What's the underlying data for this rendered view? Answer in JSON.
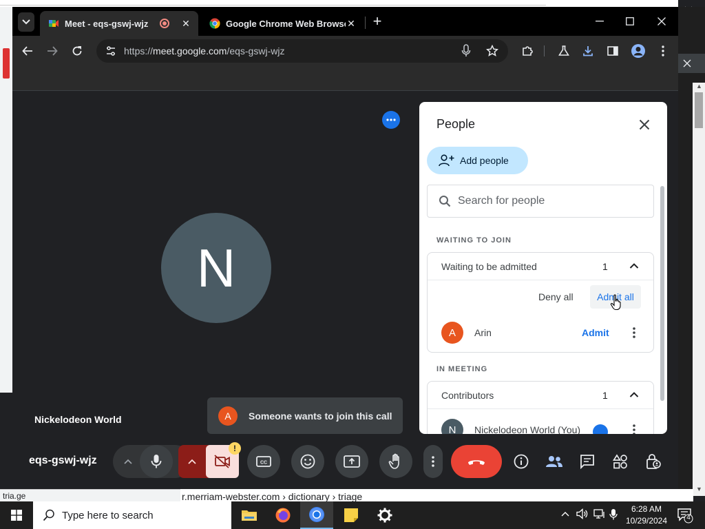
{
  "browser": {
    "tabs": [
      {
        "title": "Meet - eqs-gswj-wjz",
        "recording": true
      },
      {
        "title": "Google Chrome Web Browser",
        "recording": false
      }
    ],
    "url_prefix": "https://",
    "url_host": "meet.google.com",
    "url_path": "/eqs-gswj-wjz",
    "status_url": "tria.ge",
    "background_text": "r.merriam-webster.com › dictionary › triage"
  },
  "meet": {
    "avatar_letter": "N",
    "self_name": "Nickelodeon World",
    "meeting_code": "eqs-gswj-wjz",
    "toast": {
      "avatar": "A",
      "text": "Someone wants to join this call"
    },
    "camera_warning": "!"
  },
  "people_panel": {
    "title": "People",
    "add_people_label": "Add people",
    "search_placeholder": "Search for people",
    "waiting_section_label": "WAITING TO JOIN",
    "waiting_group": {
      "label": "Waiting to be admitted",
      "count": "1"
    },
    "deny_all_label": "Deny all",
    "admit_all_label": "Admit all",
    "waiting_people": [
      {
        "initial": "A",
        "name": "Arin",
        "action": "Admit",
        "color": "#e8551f"
      }
    ],
    "meeting_section_label": "IN MEETING",
    "contributors_group": {
      "label": "Contributors",
      "count": "1"
    },
    "meeting_people": [
      {
        "initial": "N",
        "name": "Nickelodeon World (You)",
        "color": "#4a5b64"
      }
    ]
  },
  "taskbar": {
    "search_placeholder": "Type here to search",
    "time": "6:28 AM",
    "date": "10/29/2024",
    "notification_count": "4"
  },
  "colors": {
    "accent": "#1a73e8",
    "hangup": "#ea4335",
    "meet_bg": "#202124"
  }
}
